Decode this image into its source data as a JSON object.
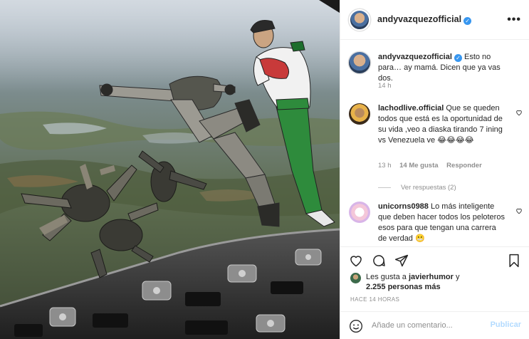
{
  "post": {
    "username": "andyvazquezofficial",
    "verified_mark": "✓",
    "more_label": "•••",
    "caption": {
      "username": "andyvazquezofficial",
      "text": "Esto no para… ay mamá. Dicen que ya vas dos.",
      "time": "14 h"
    },
    "comments": [
      {
        "username": "lachodlive.official",
        "text": "Que se queden todos que está es la oportunidad de su vida ,veo a diaska tirando 7 ining vs Venezuela ve 😂😂😂😂",
        "time": "13 h",
        "likes": "14 Me gusta",
        "reply": "Responder",
        "view_replies": "Ver respuestas (2)"
      },
      {
        "username": "unicorns0988",
        "text": "Lo más inteligente que deben hacer todos los peloteros esos para que tengan una carrera de verdad 😬"
      }
    ],
    "likes": {
      "prefix": "Les gusta a",
      "user": "javierhumor",
      "connector": "y",
      "count": "2.255 personas más"
    },
    "timestamp": "HACE 14 HORAS",
    "add_comment_placeholder": "Añade un comentario...",
    "publish_label": "Publicar"
  },
  "icons": {
    "like": "heart-icon",
    "comment": "comment-icon",
    "share": "share-icon",
    "save": "bookmark-icon",
    "emoji": "emoji-icon",
    "more": "more-icon"
  },
  "colors": {
    "accent": "#3897f0",
    "publish_disabled": "#b3dbff",
    "muted_text": "#8e8e8e"
  }
}
